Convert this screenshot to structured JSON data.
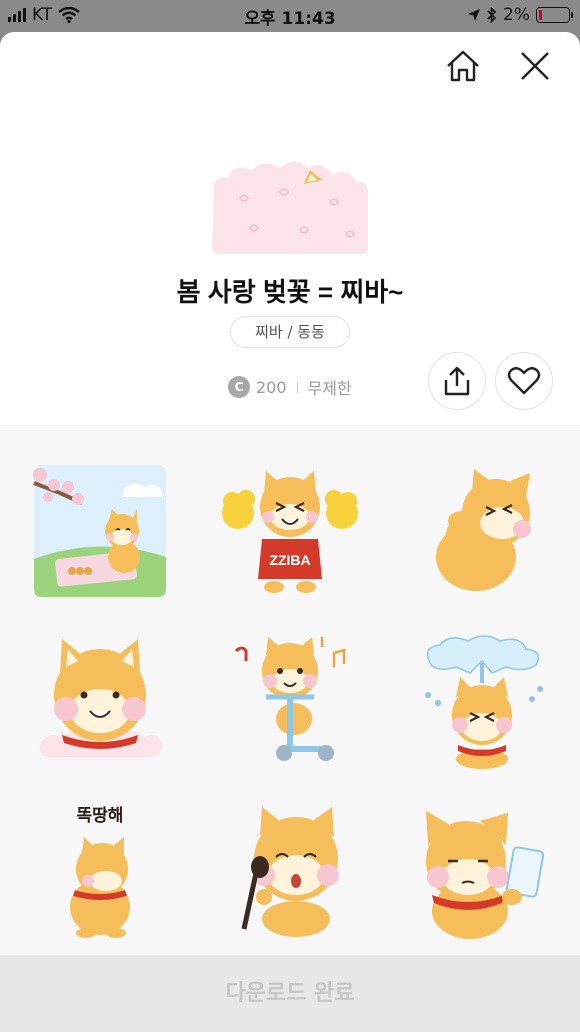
{
  "status_bar": {
    "carrier": "KT",
    "time": "오후 11:43",
    "battery_percent": "2%",
    "icons": [
      "signal-icon",
      "wifi-icon",
      "location-icon",
      "bluetooth-icon",
      "battery-icon"
    ]
  },
  "header": {
    "home_icon": "home-icon",
    "close_icon": "close-icon"
  },
  "pack": {
    "title": "봄 사랑 벚꽃 = 찌바~",
    "author": "찌바 / 동동",
    "coin_symbol": "C",
    "price": "200",
    "validity": "무제한",
    "share_icon": "share-icon",
    "favorite_icon": "heart-icon"
  },
  "stickers": [
    {
      "name": "sticker-picnic"
    },
    {
      "name": "sticker-cheerleader"
    },
    {
      "name": "sticker-laughing"
    },
    {
      "name": "sticker-smiling"
    },
    {
      "name": "sticker-scooter"
    },
    {
      "name": "sticker-fountain"
    },
    {
      "name": "sticker-ttokttakhae",
      "caption": "똑땅해"
    },
    {
      "name": "sticker-singing"
    },
    {
      "name": "sticker-phone"
    }
  ],
  "footer": {
    "download_label": "다운로드 완료"
  },
  "colors": {
    "fur": "#F5BE5B",
    "cheek": "#F8C6CF",
    "scarf": "#D43A2A",
    "sakura": "#FBE3E8",
    "download_bg": "#E7E7E7",
    "download_text": "#C6C6C6"
  }
}
